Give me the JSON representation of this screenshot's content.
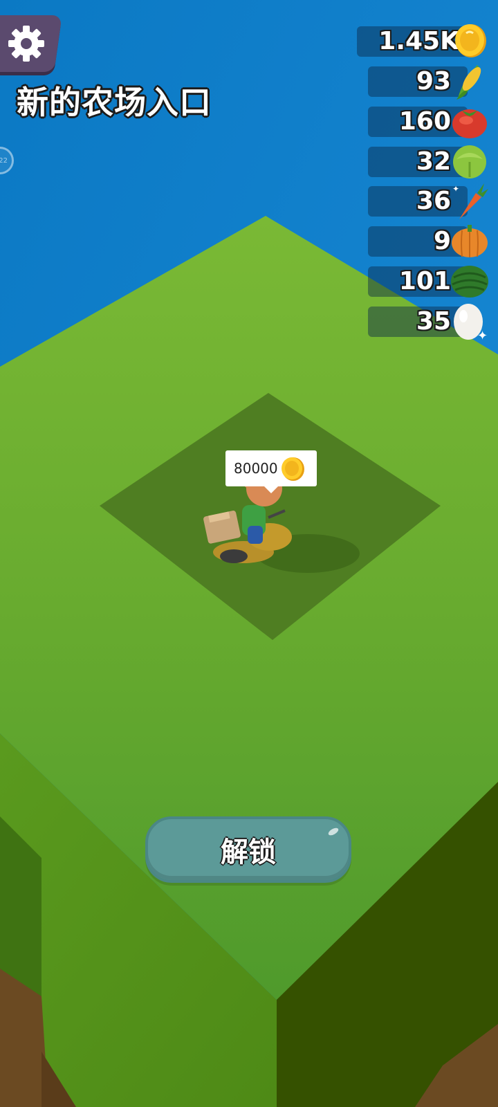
{
  "header": {
    "title": "新的农场入口",
    "side_badge": "22"
  },
  "resources": [
    {
      "name": "coin",
      "value": "1.45K"
    },
    {
      "name": "corn",
      "value": "93"
    },
    {
      "name": "tomato",
      "value": "160"
    },
    {
      "name": "cabbage",
      "value": "32"
    },
    {
      "name": "carrot",
      "value": "36"
    },
    {
      "name": "pumpkin",
      "value": "9"
    },
    {
      "name": "watermelon",
      "value": "101"
    },
    {
      "name": "egg",
      "value": "35"
    }
  ],
  "plot": {
    "price": "80000"
  },
  "unlock_button": {
    "label": "解锁"
  },
  "colors": {
    "sky": "#0a7ec9",
    "grass_top": "#6fb02c",
    "plot_dark": "#4f7e22",
    "button": "#5c9a98",
    "settings": "#5b4a6e"
  }
}
